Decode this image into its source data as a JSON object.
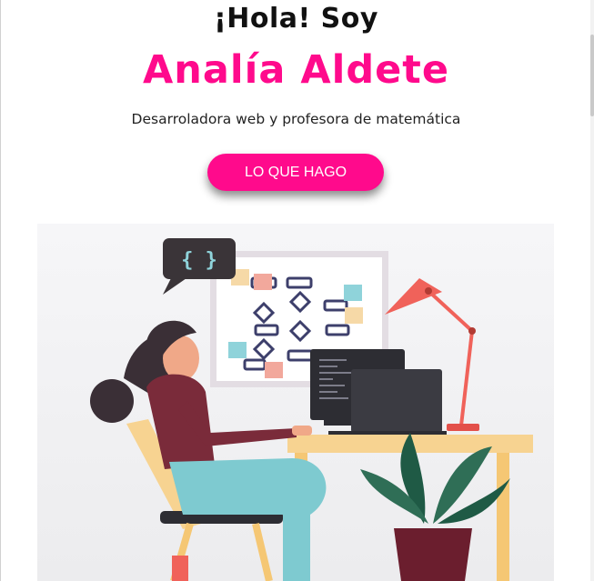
{
  "hero": {
    "greeting": "¡Hola! Soy",
    "name": "Analía Aldete",
    "subtitle": "Desarroladora web y profesora de matemática",
    "cta_label": "LO QUE HAGO"
  },
  "illustration": {
    "bubble_text": "{ }",
    "icon": "woman-at-laptop-illustration"
  },
  "colors": {
    "accent": "#ff0a8c",
    "text": "#111111"
  }
}
